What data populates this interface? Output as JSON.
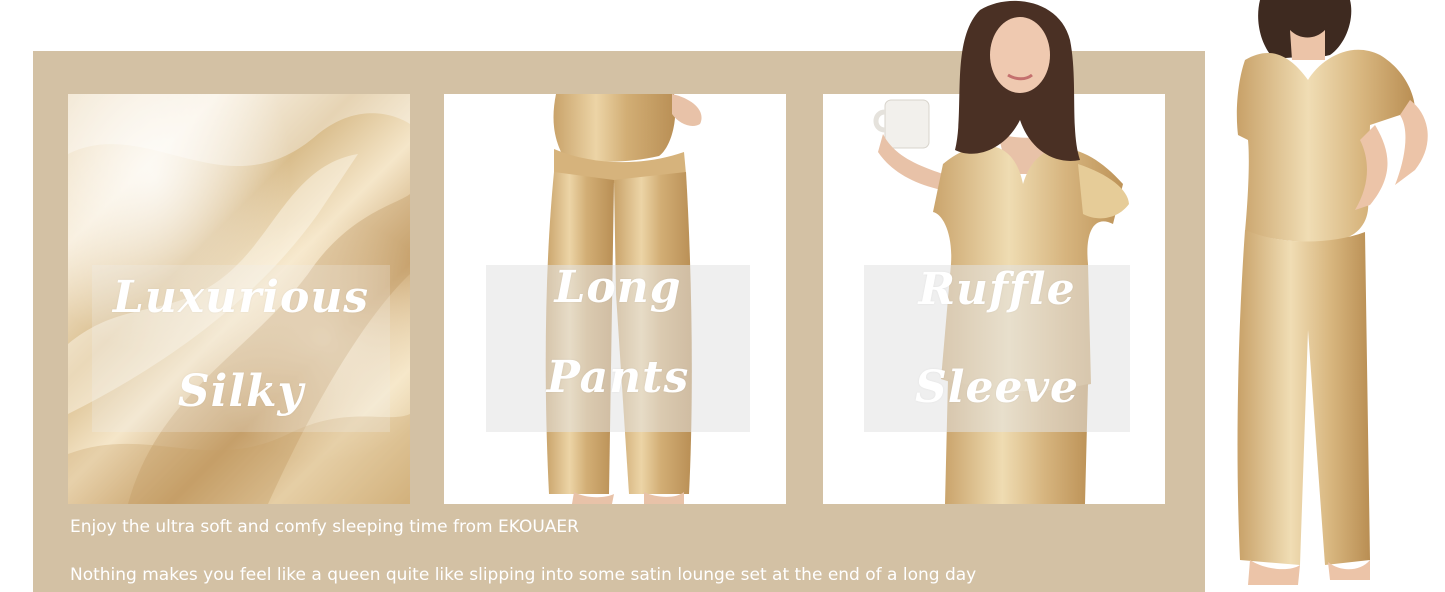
{
  "banner": {
    "tiles": [
      {
        "lines": [
          "Luxurious",
          "Silky"
        ]
      },
      {
        "lines": [
          "Long",
          "Pants"
        ]
      },
      {
        "lines": [
          "Ruffle",
          "Sleeve"
        ]
      }
    ],
    "captions": [
      "Enjoy the ultra soft and comfy sleeping time from EKOUAER",
      "Nothing makes you feel like a queen quite like slipping into some satin lounge set at the end of a long day"
    ]
  },
  "colors": {
    "panel": "#d3c1a4",
    "satin": "#d8b986",
    "overlay": "#e6e6e6",
    "text": "#ffffff"
  }
}
